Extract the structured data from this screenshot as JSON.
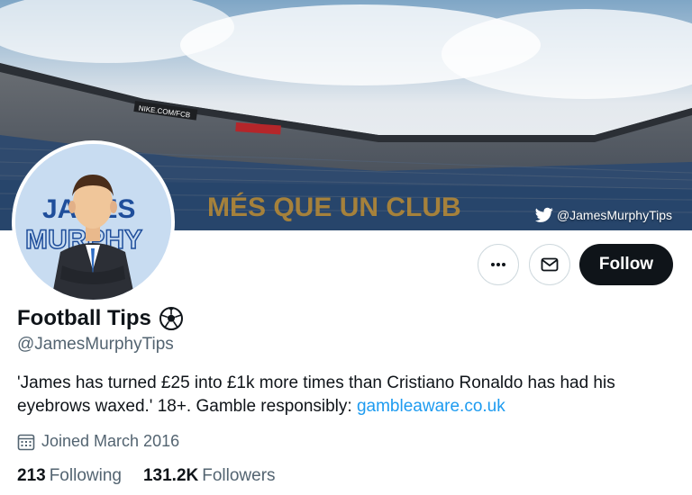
{
  "banner": {
    "watermark": "@JamesMurphyTips",
    "stadium_sign_1": "NIKE.COM/FCB",
    "stadium_sign_2": "MÉS QUE UN CLUB"
  },
  "avatar": {
    "line1": "JAMES",
    "line2": "MURPHY"
  },
  "profile": {
    "display_name": "Football Tips",
    "handle": "@JamesMurphyTips",
    "bio_text": "'James has turned £25 into £1k more times than Cristiano Ronaldo has had his eyebrows waxed.' 18+. Gamble responsibly: ",
    "bio_link": "gambleaware.co.uk",
    "joined": "Joined March 2016"
  },
  "actions": {
    "follow_label": "Follow"
  },
  "stats": {
    "following_count": "213",
    "following_label": "Following",
    "followers_count": "131.2K",
    "followers_label": "Followers"
  },
  "colors": {
    "link": "#1d9bf0",
    "follow_bg": "#0f1419",
    "secondary_text": "#536471"
  }
}
